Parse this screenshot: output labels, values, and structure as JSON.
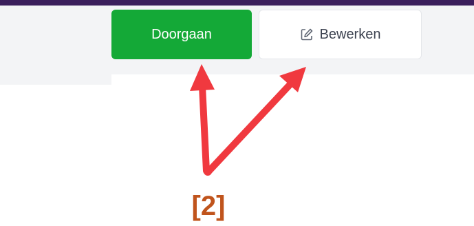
{
  "actions": {
    "continue_label": "Doorgaan",
    "edit_label": "Bewerken",
    "edit_icon": "edit-icon"
  },
  "annotation": {
    "step_marker": "[2]",
    "arrow_color": "#f0393f"
  },
  "colors": {
    "primary_button": "#14a937",
    "top_bar": "#3b1f5c",
    "marker_text": "#c0541c"
  }
}
